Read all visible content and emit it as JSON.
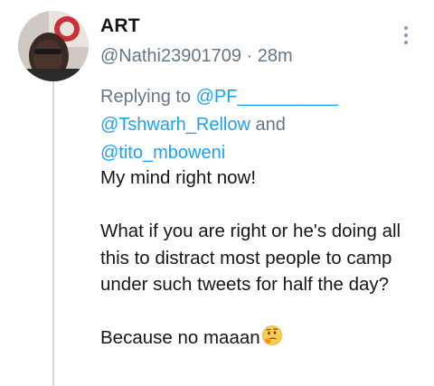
{
  "tweet": {
    "display_name": "ART",
    "handle": "@Nathi23901709",
    "separator": "·",
    "time_ago": "28m",
    "reply_prefix": "Replying to",
    "mentions": [
      "@PF__________",
      "@Tshwarh_Rellow",
      "@tito_mboweni"
    ],
    "reply_joiner": "and",
    "lines": [
      "My mind right now!",
      "What if you are right or he's doing all this to distract most people to camp under such tweets for half the day?",
      "Because no maaan"
    ],
    "emoji": "thinking-face"
  },
  "colors": {
    "link": "#1da1f2",
    "secondary_text": "#657786",
    "primary_text": "#14171a",
    "thread_line": "#cfd9de"
  }
}
